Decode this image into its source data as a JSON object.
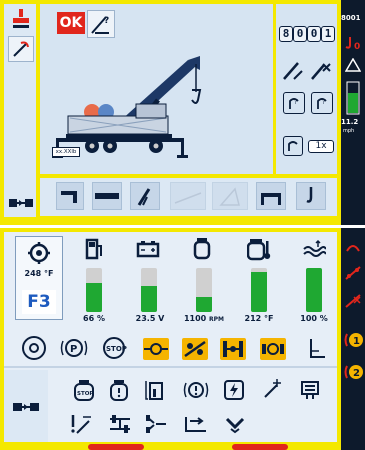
{
  "top": {
    "ok_label": "OK",
    "counter_digits": [
      "8",
      "0",
      "0",
      "1"
    ],
    "load_tag": "xx.XXlb",
    "mode_badge": "1x",
    "toolbar_icons": [
      "jib-icon",
      "boom-section-icon",
      "crane-config-icon",
      "disabled-icon",
      "disabled-icon",
      "outrigger-icon",
      "hook-icon"
    ]
  },
  "right_strip_top": {
    "value_1": "8001",
    "speed_value": "11.2",
    "speed_unit": "mph"
  },
  "bottom": {
    "oil_temp": "248 °F",
    "gear": "F3",
    "gauges": [
      {
        "name": "fuel",
        "icon": "fuel-pump-icon",
        "value": "66 %",
        "level": 0.66
      },
      {
        "name": "battery",
        "icon": "battery-icon",
        "value": "23.5 V",
        "level": 0.6
      },
      {
        "name": "rpm",
        "icon": "engine-icon",
        "value": "1100",
        "unit": "RPM",
        "level": 0.35
      },
      {
        "name": "engine-temp",
        "icon": "engine-temp-icon",
        "value": "212 °F",
        "level": 0.9
      },
      {
        "name": "coolant",
        "icon": "coolant-level-icon",
        "value": "100 %",
        "level": 1.0
      }
    ],
    "status_row": [
      "brake-warning-icon",
      "parking-brake-icon",
      "stop-icon",
      "differential-lock-front-icon",
      "axle-lock-icon",
      "differential-lock-center-icon",
      "differential-lock-rear-icon",
      "inclination-icon"
    ],
    "status_row_2": [
      "engine-stop-icon",
      "engine-warning-icon",
      "oil-level-icon",
      "brake-circuit-icon",
      "charging-icon",
      "steering-icon",
      "display-icon"
    ],
    "status_row_3": [
      "emergency-steering-icon",
      "axle-steer-icon",
      "all-wheel-steer-icon",
      "crab-steer-icon",
      "down-chevron-icon"
    ]
  }
}
